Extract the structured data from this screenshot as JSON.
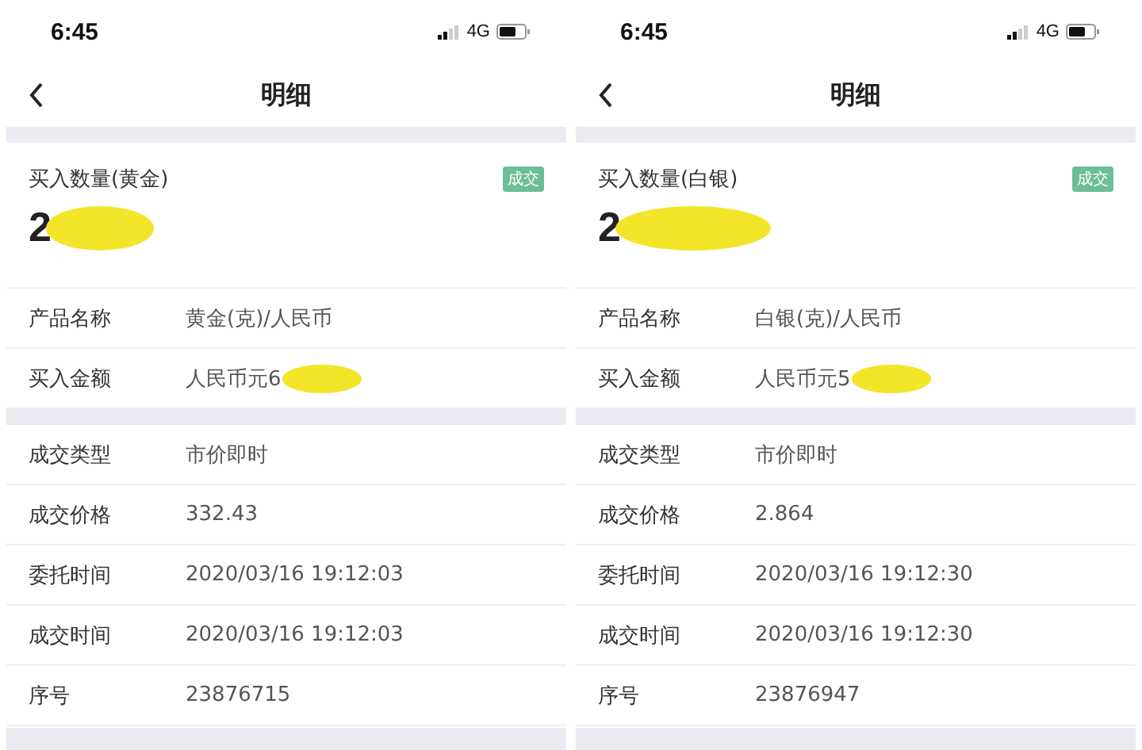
{
  "screens": [
    {
      "status_bar": {
        "time": "6:45",
        "network": "4G"
      },
      "title": "明细",
      "quantity": {
        "label": "买入数量(黄金)",
        "value": "2",
        "redacted": true
      },
      "badge": "成交",
      "groups": [
        [
          {
            "label": "产品名称",
            "value": "黄金(克)/人民币"
          },
          {
            "label": "买入金额",
            "value": "人民币元6",
            "redacted": true
          }
        ],
        [
          {
            "label": "成交类型",
            "value": "市价即时"
          },
          {
            "label": "成交价格",
            "value": "332.43"
          },
          {
            "label": "委托时间",
            "value": "2020/03/16 19:12:03"
          },
          {
            "label": "成交时间",
            "value": "2020/03/16 19:12:03"
          },
          {
            "label": "序号",
            "value": "23876715"
          }
        ]
      ]
    },
    {
      "status_bar": {
        "time": "6:45",
        "network": "4G"
      },
      "title": "明细",
      "quantity": {
        "label": "买入数量(白银)",
        "value": "2",
        "redacted": true
      },
      "badge": "成交",
      "groups": [
        [
          {
            "label": "产品名称",
            "value": "白银(克)/人民币"
          },
          {
            "label": "买入金额",
            "value": "人民币元5",
            "redacted": true
          }
        ],
        [
          {
            "label": "成交类型",
            "value": "市价即时"
          },
          {
            "label": "成交价格",
            "value": "2.864"
          },
          {
            "label": "委托时间",
            "value": "2020/03/16 19:12:30"
          },
          {
            "label": "成交时间",
            "value": "2020/03/16 19:12:30"
          },
          {
            "label": "序号",
            "value": "23876947"
          }
        ]
      ]
    }
  ]
}
